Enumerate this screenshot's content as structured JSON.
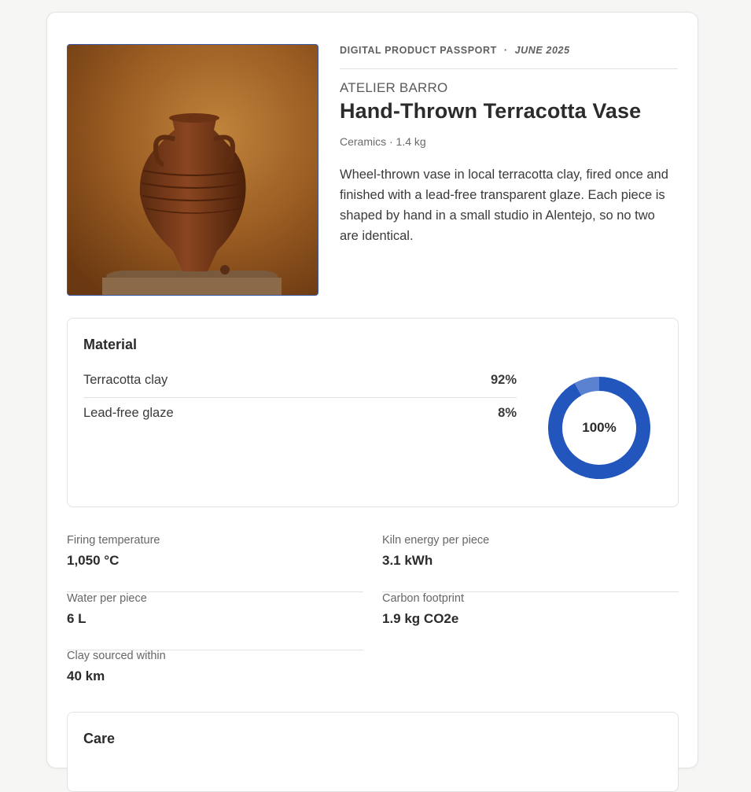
{
  "header": {
    "passport_label": "DIGITAL PRODUCT PASSPORT",
    "separator": "·",
    "date": "JUNE 2025"
  },
  "product": {
    "brand": "ATELIER BARRO",
    "title": "Hand-Thrown Terracotta Vase",
    "subtitle": "Ceramics · 1.4 kg",
    "description": "Wheel-thrown vase in local terracotta clay, fired once and finished with a lead-free transparent glaze. Each piece is shaped by hand in a small studio in Alentejo, so no two are identical."
  },
  "material": {
    "title": "Material",
    "items": [
      {
        "name": "Terracotta clay",
        "value": "92%"
      },
      {
        "name": "Lead-free glaze",
        "value": "8%"
      }
    ],
    "total_label": "100%"
  },
  "chart_data": {
    "type": "pie",
    "categories": [
      "Terracotta clay",
      "Lead-free glaze"
    ],
    "values": [
      92,
      8
    ],
    "colors": [
      "#2256bd",
      "#5b82d1"
    ],
    "title": "",
    "center_label": "100%"
  },
  "specs": [
    {
      "label": "Firing temperature",
      "value": "1,050 °C"
    },
    {
      "label": "Kiln energy per piece",
      "value": "3.1 kWh"
    },
    {
      "label": "Water per piece",
      "value": "6 L"
    },
    {
      "label": "Carbon footprint",
      "value": "1.9 kg CO2e"
    },
    {
      "label": "Clay sourced within",
      "value": "40 km"
    }
  ],
  "care": {
    "title": "Care"
  },
  "colors": {
    "accent": "#2256bd",
    "accent_light": "#5b82d1",
    "border": "#e2e2e2"
  }
}
